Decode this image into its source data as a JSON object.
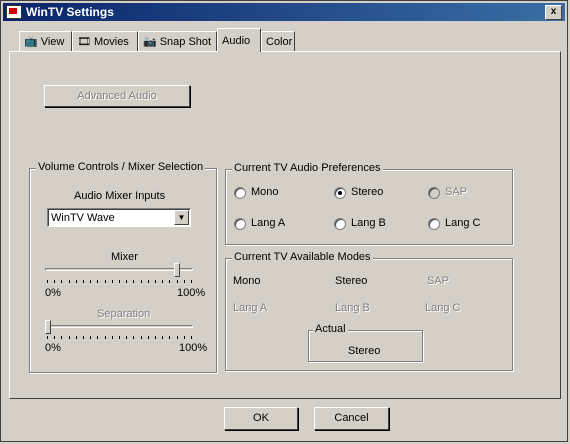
{
  "window": {
    "title": "WinTV Settings",
    "close_label": "x"
  },
  "tabs": [
    {
      "label": "View",
      "icon": "tv-icon"
    },
    {
      "label": "Movies",
      "icon": "film-icon"
    },
    {
      "label": "Snap Shot",
      "icon": "camera-icon"
    },
    {
      "label": "Audio"
    },
    {
      "label": "Color"
    }
  ],
  "active_tab": "Audio",
  "advanced_audio_label": "Advanced Audio",
  "volume_group": {
    "title": "Volume Controls / Mixer Selection",
    "inputs_label": "Audio Mixer Inputs",
    "inputs_selected": "WinTV Wave",
    "mixer_label": "Mixer",
    "mixer_level": 0.91,
    "separation_label": "Separation",
    "separation_level": 0.0,
    "min_label": "0%",
    "max_label": "100%"
  },
  "prefs_group": {
    "title": "Current TV Audio Preferences",
    "options": [
      "Mono",
      "Stereo",
      "SAP",
      "Lang A",
      "Lang B",
      "Lang C"
    ],
    "selected": "Stereo"
  },
  "modes_group": {
    "title": "Current TV Available Modes",
    "modes": [
      "Mono",
      "Stereo",
      "SAP",
      "Lang A",
      "Lang B",
      "Lang C"
    ],
    "actual_label": "Actual",
    "actual_value": "Stereo"
  },
  "buttons": {
    "ok": "OK",
    "cancel": "Cancel"
  }
}
